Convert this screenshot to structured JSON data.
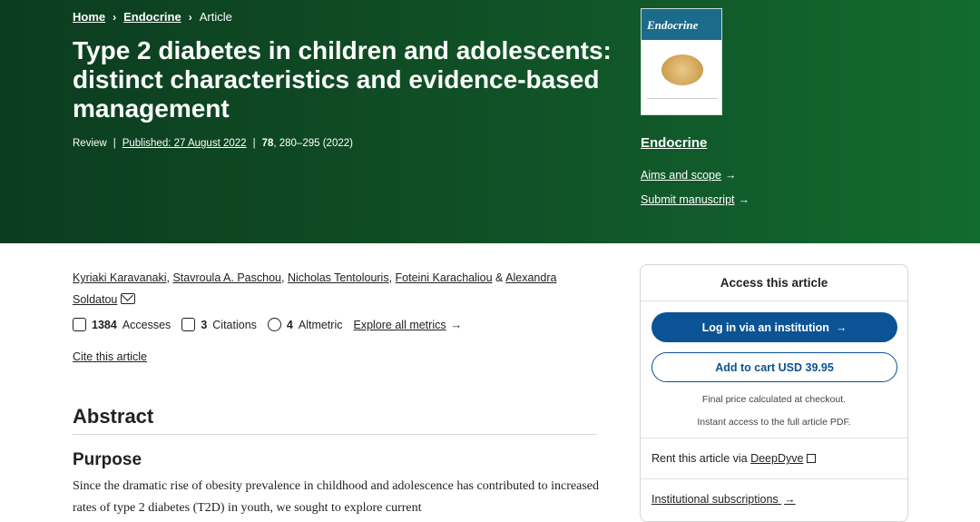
{
  "breadcrumb": {
    "home": "Home",
    "journal": "Endocrine",
    "current": "Article",
    "separator": "›"
  },
  "article": {
    "title": "Type 2 diabetes in children and adolescents: distinct characteristics and evidence-based management",
    "type": "Review",
    "published": "Published: 27 August 2022",
    "volume": "78",
    "pages": ", 280–295 (2022)"
  },
  "sidebar": {
    "cover_title": "Endocrine",
    "journal_name": "Endocrine",
    "aims_label": "Aims and scope",
    "submit_label": "Submit manuscript",
    "arrow": "→"
  },
  "authors": {
    "list": [
      "Kyriaki Karavanaki",
      "Stavroula A. Paschou",
      "Nicholas Tentolouris",
      "Foteini Karachaliou",
      "Alexandra Soldatou"
    ],
    "separators": [
      ", ",
      ", ",
      ", ",
      " & "
    ]
  },
  "metrics": {
    "accesses_count": "1384",
    "accesses_label": "Accesses",
    "citations_count": "3",
    "citations_label": "Citations",
    "altmetric_count": "4",
    "altmetric_label": "Altmetric",
    "explore_label": "Explore all metrics",
    "arrow": "→"
  },
  "cite_label": "Cite this article",
  "abstract": {
    "heading": "Abstract",
    "purpose_heading": "Purpose",
    "text": "Since the dramatic rise of obesity prevalence in childhood and adolescence has contributed to increased rates of type 2 diabetes (T2D) in youth, we sought to explore current"
  },
  "access": {
    "heading": "Access this article",
    "login_label": "Log in via an institution",
    "cart_label": "Add to cart USD 39.95",
    "note_price": "Final price calculated at checkout.",
    "note_access": "Instant access to the full article PDF.",
    "rent_prefix": "Rent this article via ",
    "rent_link": "DeepDyve",
    "inst_label": "Institutional subscriptions",
    "arrow": "→"
  },
  "colors": {
    "hero_green": "#0f4a24",
    "primary_blue": "#0b5394"
  }
}
